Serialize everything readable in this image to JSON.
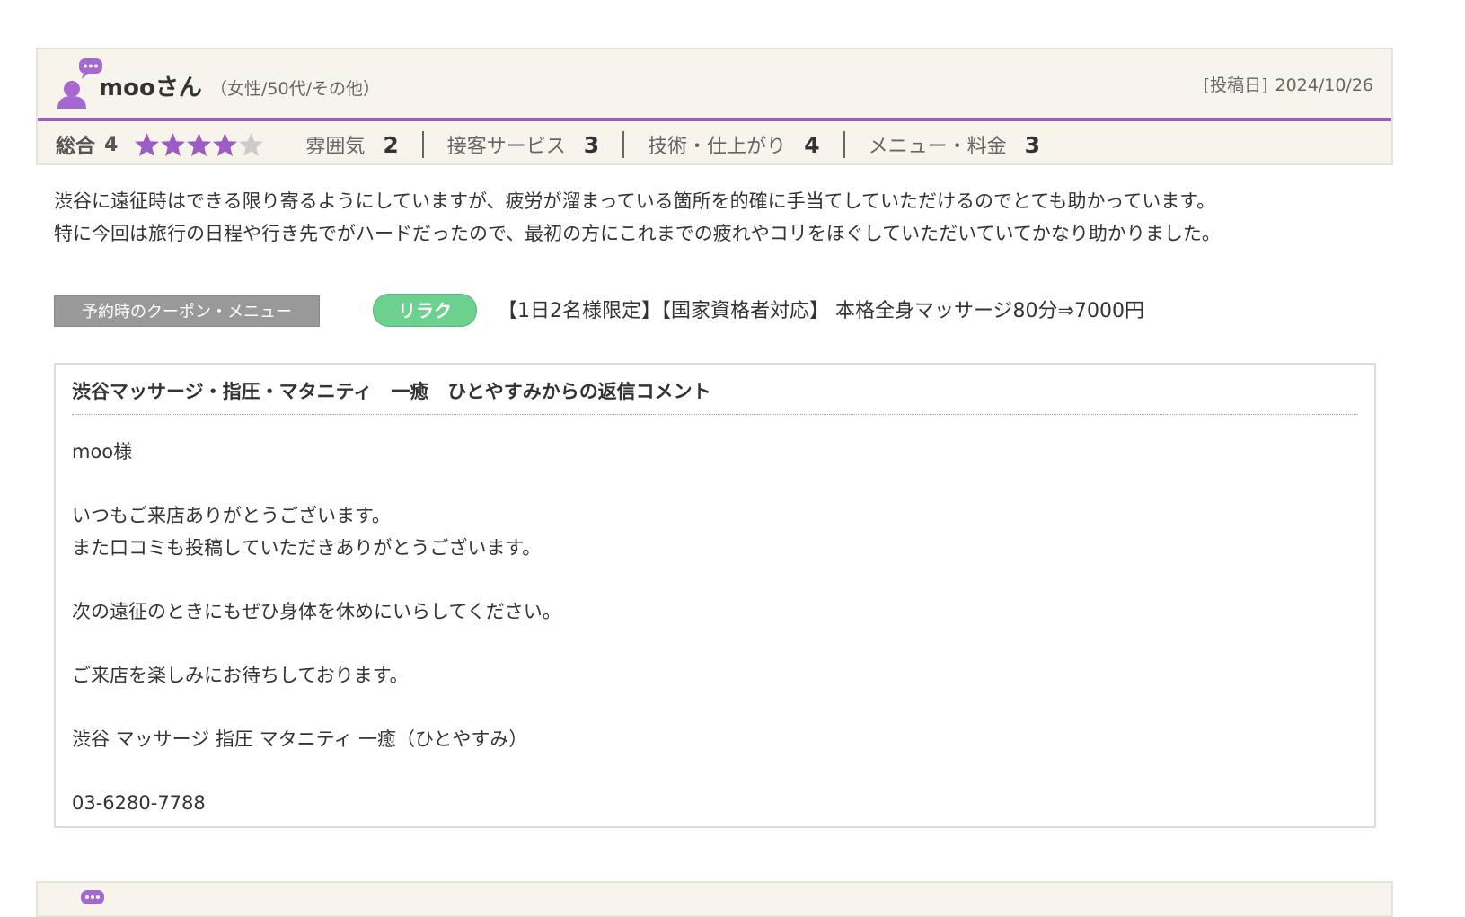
{
  "review": {
    "user_name": "mooさん",
    "user_attributes": "（女性/50代/その他）",
    "posted_label": "[投稿日]",
    "posted_date": "2024/10/26",
    "overall_label": "総合",
    "overall_value": "4",
    "overall_rating": 4,
    "max_rating": 5,
    "ratings": [
      {
        "label": "雰囲気",
        "value": "2"
      },
      {
        "label": "接客サービス",
        "value": "3"
      },
      {
        "label": "技術・仕上がり",
        "value": "4"
      },
      {
        "label": "メニュー・料金",
        "value": "3"
      }
    ],
    "body_lines": [
      "渋谷に遠征時はできる限り寄るようにしていますが、疲労が溜まっている箇所を的確に手当てしていただけるのでとても助かっています。",
      "特に今回は旅行の日程や行き先でがハードだったので、最初の方にこれまでの疲れやコリをほぐしていただいていてかなり助かりました。"
    ]
  },
  "coupon": {
    "tag_label": "予約時のクーポン・メニュー",
    "badge": "リラク",
    "text": "【1日2名様限定】【国家資格者対応】 本格全身マッサージ80分⇒7000円"
  },
  "reply": {
    "title": "渋谷マッサージ・指圧・マタニティ　一癒　ひとやすみからの返信コメント",
    "body": "moo様\n\nいつもご来店ありがとうございます。\nまた口コミも投稿していただきありがとうございます。\n\n次の遠征のときにもぜひ身体を休めにいらしてください。\n\nご来店を楽しみにお待ちしております。\n\n渋谷 マッサージ 指圧 マタニティ 一癒（ひとやすみ）\n\n03-6280-7788"
  },
  "colors": {
    "accent_purple": "#9b5cc4",
    "badge_green": "#6cd08e",
    "header_bg": "#f7f4ec",
    "star_empty": "#cccccc"
  },
  "icons": {
    "user": "user-comment-icon",
    "star": "star-icon"
  }
}
